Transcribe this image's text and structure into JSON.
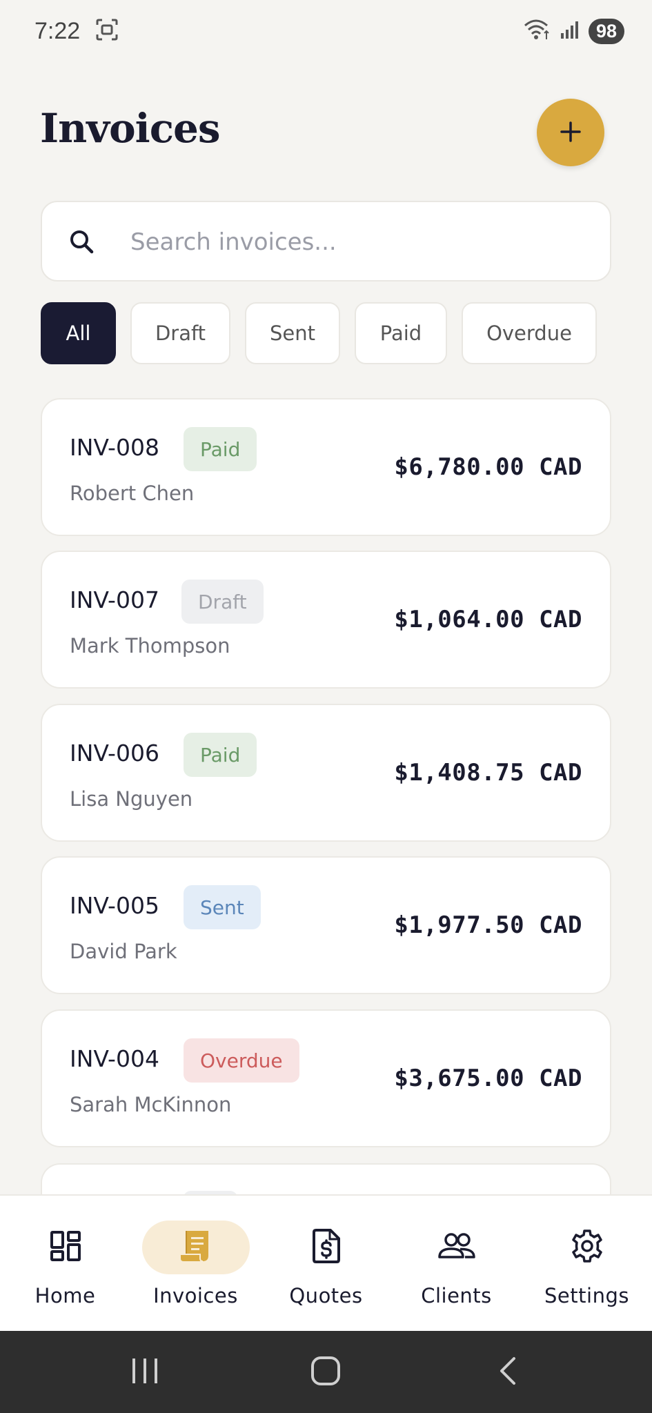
{
  "status_bar": {
    "time": "7:22",
    "battery": "98",
    "icons": [
      "screenshot-icon",
      "wifi-icon",
      "signal-icon"
    ]
  },
  "header": {
    "title": "Invoices",
    "add_button_icon": "plus-icon",
    "accent_color": "#d9a93f"
  },
  "search": {
    "placeholder": "Search invoices...",
    "value": ""
  },
  "filters": [
    {
      "label": "All",
      "active": true
    },
    {
      "label": "Draft",
      "active": false
    },
    {
      "label": "Sent",
      "active": false
    },
    {
      "label": "Paid",
      "active": false
    },
    {
      "label": "Overdue",
      "active": false
    }
  ],
  "invoices": [
    {
      "number": "INV-008",
      "status": "Paid",
      "client": "Robert Chen",
      "amount": "$6,780.00 CAD"
    },
    {
      "number": "INV-007",
      "status": "Draft",
      "client": "Mark Thompson",
      "amount": "$1,064.00 CAD"
    },
    {
      "number": "INV-006",
      "status": "Paid",
      "client": "Lisa Nguyen",
      "amount": "$1,408.75 CAD"
    },
    {
      "number": "INV-005",
      "status": "Sent",
      "client": "David Park",
      "amount": "$1,977.50 CAD"
    },
    {
      "number": "INV-004",
      "status": "Overdue",
      "client": "Sarah McKinnon",
      "amount": "$3,675.00 CAD"
    }
  ],
  "status_colors": {
    "Paid": "#6a9a67",
    "Draft": "#a2a4ab",
    "Sent": "#5b86b9",
    "Overdue": "#cc5b5b"
  },
  "bottom_nav": [
    {
      "label": "Home",
      "icon": "dashboard-icon",
      "active": false
    },
    {
      "label": "Invoices",
      "icon": "receipt-icon",
      "active": true
    },
    {
      "label": "Quotes",
      "icon": "document-dollar-icon",
      "active": false
    },
    {
      "label": "Clients",
      "icon": "people-icon",
      "active": false
    },
    {
      "label": "Settings",
      "icon": "gear-icon",
      "active": false
    }
  ],
  "system_nav": [
    "recents-icon",
    "home-icon",
    "back-icon"
  ]
}
